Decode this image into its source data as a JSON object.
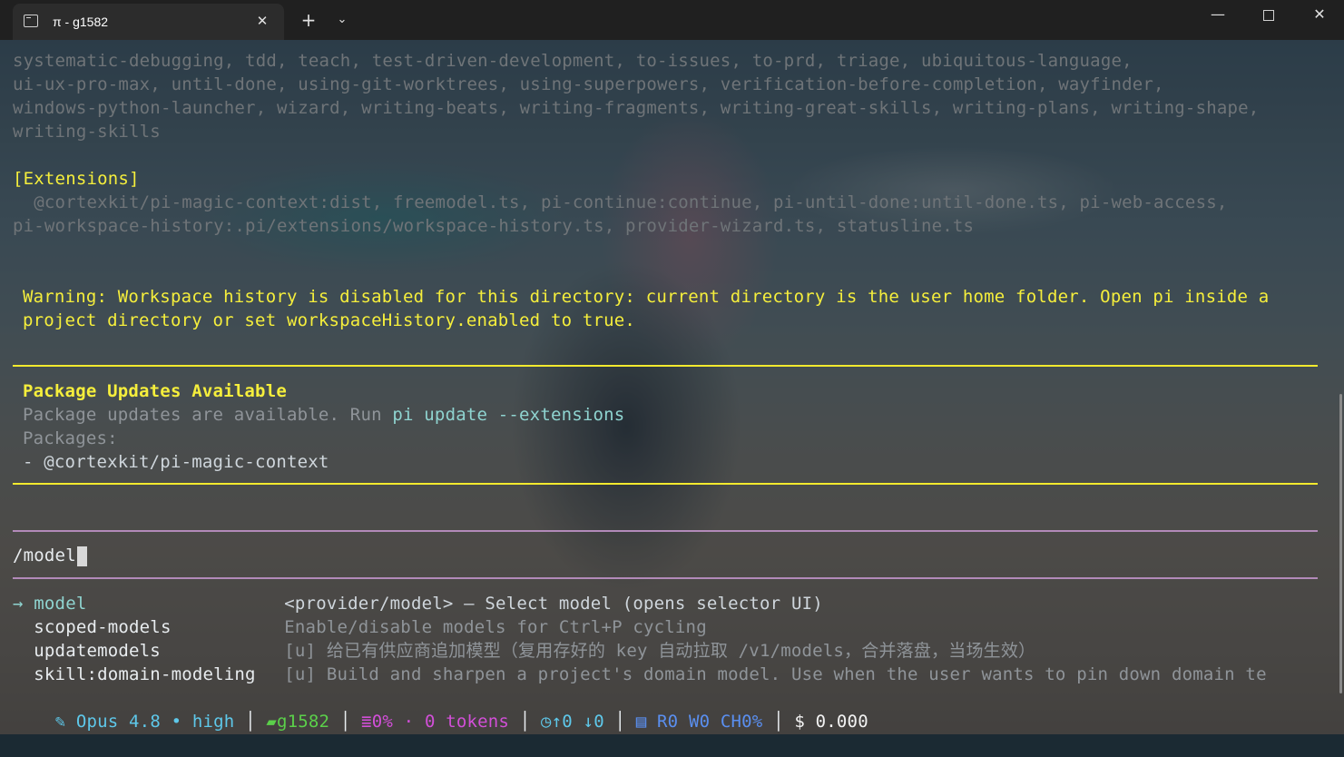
{
  "window": {
    "tab_title": "π - g1582",
    "tab_close": "✕",
    "new_tab": "+",
    "tab_menu": "⌄",
    "minimize": "—",
    "close": "✕"
  },
  "skills_lines": [
    "systematic-debugging, tdd, teach, test-driven-development, to-issues, to-prd, triage, ubiquitous-language,",
    "ui-ux-pro-max, until-done, using-git-worktrees, using-superpowers, verification-before-completion, wayfinder,",
    "windows-python-launcher, wizard, writing-beats, writing-fragments, writing-great-skills, writing-plans, writing-shape,",
    "writing-skills"
  ],
  "extensions": {
    "header": "[Extensions]",
    "lines": [
      "  @cortexkit/pi-magic-context:dist, freemodel.ts, pi-continue:continue, pi-until-done:until-done.ts, pi-web-access,",
      "pi-workspace-history:.pi/extensions/workspace-history.ts, provider-wizard.ts, statusline.ts"
    ]
  },
  "warning": {
    "line1": "Warning: Workspace history is disabled for this directory: current directory is the user home folder. Open pi inside a",
    "line2": "project directory or set workspaceHistory.enabled to true."
  },
  "updates": {
    "title": "Package Updates Available",
    "run_prefix": "Package updates are available. Run ",
    "command": "pi update --extensions",
    "packages_label": "Packages:",
    "package_item": "- @cortexkit/pi-magic-context"
  },
  "input": {
    "value": "/model"
  },
  "commands": [
    {
      "pointer": "→ ",
      "name": "model",
      "desc": "<provider/model> — Select model (opens selector UI)"
    },
    {
      "pointer": "  ",
      "name": "scoped-models",
      "desc": "Enable/disable models for Ctrl+P cycling"
    },
    {
      "pointer": "  ",
      "name": "updatemodels",
      "desc": "[u] 给已有供应商追加模型（复用存好的 key 自动拉取 /v1/models，合并落盘，当场生效）"
    },
    {
      "pointer": "  ",
      "name": "skill:domain-modeling",
      "desc": "[u] Build and sharpen a project's domain model. Use when the user wants to pin down domain te"
    }
  ],
  "status": {
    "model": "Opus 4.8 • high",
    "folder": "g1582",
    "context": "0% · 0 tokens",
    "sync": "↑0 ↓0",
    "files": "R0 W0 CH0%",
    "cost": "$ 0.000",
    "separator": "│",
    "colors": {
      "model": "#5ec8ea",
      "folder": "#5bd04a",
      "context": "#d24fd8",
      "sync": "#5ec8ea",
      "files": "#5a8ff0",
      "cost": "#f2f2f2"
    },
    "icons": [
      "feather-icon",
      "folder-icon",
      "database-icon",
      "clock-icon",
      "file-icon"
    ]
  },
  "colors": {
    "warning": "#f5ee3c",
    "rule_yellow": "#f3ea2e",
    "rule_purple": "#b28ab9",
    "command_teal": "#8fd4d0"
  }
}
